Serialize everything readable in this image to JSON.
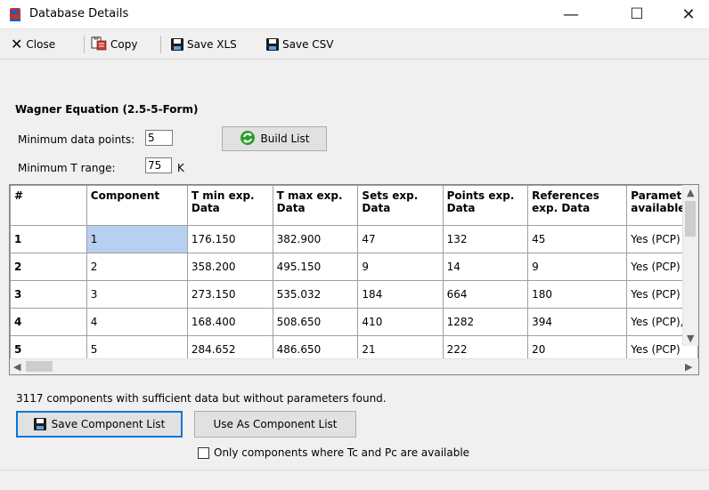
{
  "window": {
    "title": "Database Details",
    "minimize_glyph": "—",
    "maximize_glyph": "☐",
    "close_glyph": "✕"
  },
  "toolbar": {
    "close_label": "Close",
    "copy_label": "Copy",
    "save_xls_label": "Save XLS",
    "save_csv_label": "Save CSV"
  },
  "section": {
    "title": "Wagner Equation (2.5-5-Form)",
    "min_points_label": "Minimum data points:",
    "min_points_value": "5",
    "min_trange_label": "Minimum T range:",
    "min_trange_value": "75",
    "min_trange_unit": "K",
    "build_list_label": "Build List"
  },
  "grid": {
    "columns": [
      "#",
      "Component",
      "T min exp. Data",
      "T max exp. Data",
      "Sets exp. Data",
      "Points exp. Data",
      "References exp. Data",
      "Paramet available"
    ],
    "rows": [
      {
        "num": "1",
        "component": "1",
        "tmin": "176.150",
        "tmax": "382.900",
        "sets": "47",
        "points": "132",
        "refs": "45",
        "params": "Yes (PCP)"
      },
      {
        "num": "2",
        "component": "2",
        "tmin": "358.200",
        "tmax": "495.150",
        "sets": "9",
        "points": "14",
        "refs": "9",
        "params": "Yes (PCP)"
      },
      {
        "num": "3",
        "component": "3",
        "tmin": "273.150",
        "tmax": "535.032",
        "sets": "184",
        "points": "664",
        "refs": "180",
        "params": "Yes (PCP)"
      },
      {
        "num": "4",
        "component": "4",
        "tmin": "168.400",
        "tmax": "508.650",
        "sets": "410",
        "points": "1282",
        "refs": "394",
        "params": "Yes (PCP),"
      },
      {
        "num": "5",
        "component": "5",
        "tmin": "284.652",
        "tmax": "486.650",
        "sets": "21",
        "points": "222",
        "refs": "20",
        "params": "Yes (PCP)"
      }
    ]
  },
  "footer": {
    "status_text": "3117 components with sufficient data but without parameters found.",
    "save_component_list_label": "Save Component List",
    "use_as_component_list_label": "Use As Component List",
    "only_tc_pc_label": "Only components where Tc and Pc are available"
  },
  "colors": {
    "selection": "#b7cff0",
    "focus_border": "#0078d7",
    "build_icon": "#2a9d2a"
  },
  "icons": {
    "app": "database-icon",
    "close": "x-icon",
    "copy": "copy-icon",
    "save": "floppy-disk-icon",
    "build": "refresh-icon"
  }
}
